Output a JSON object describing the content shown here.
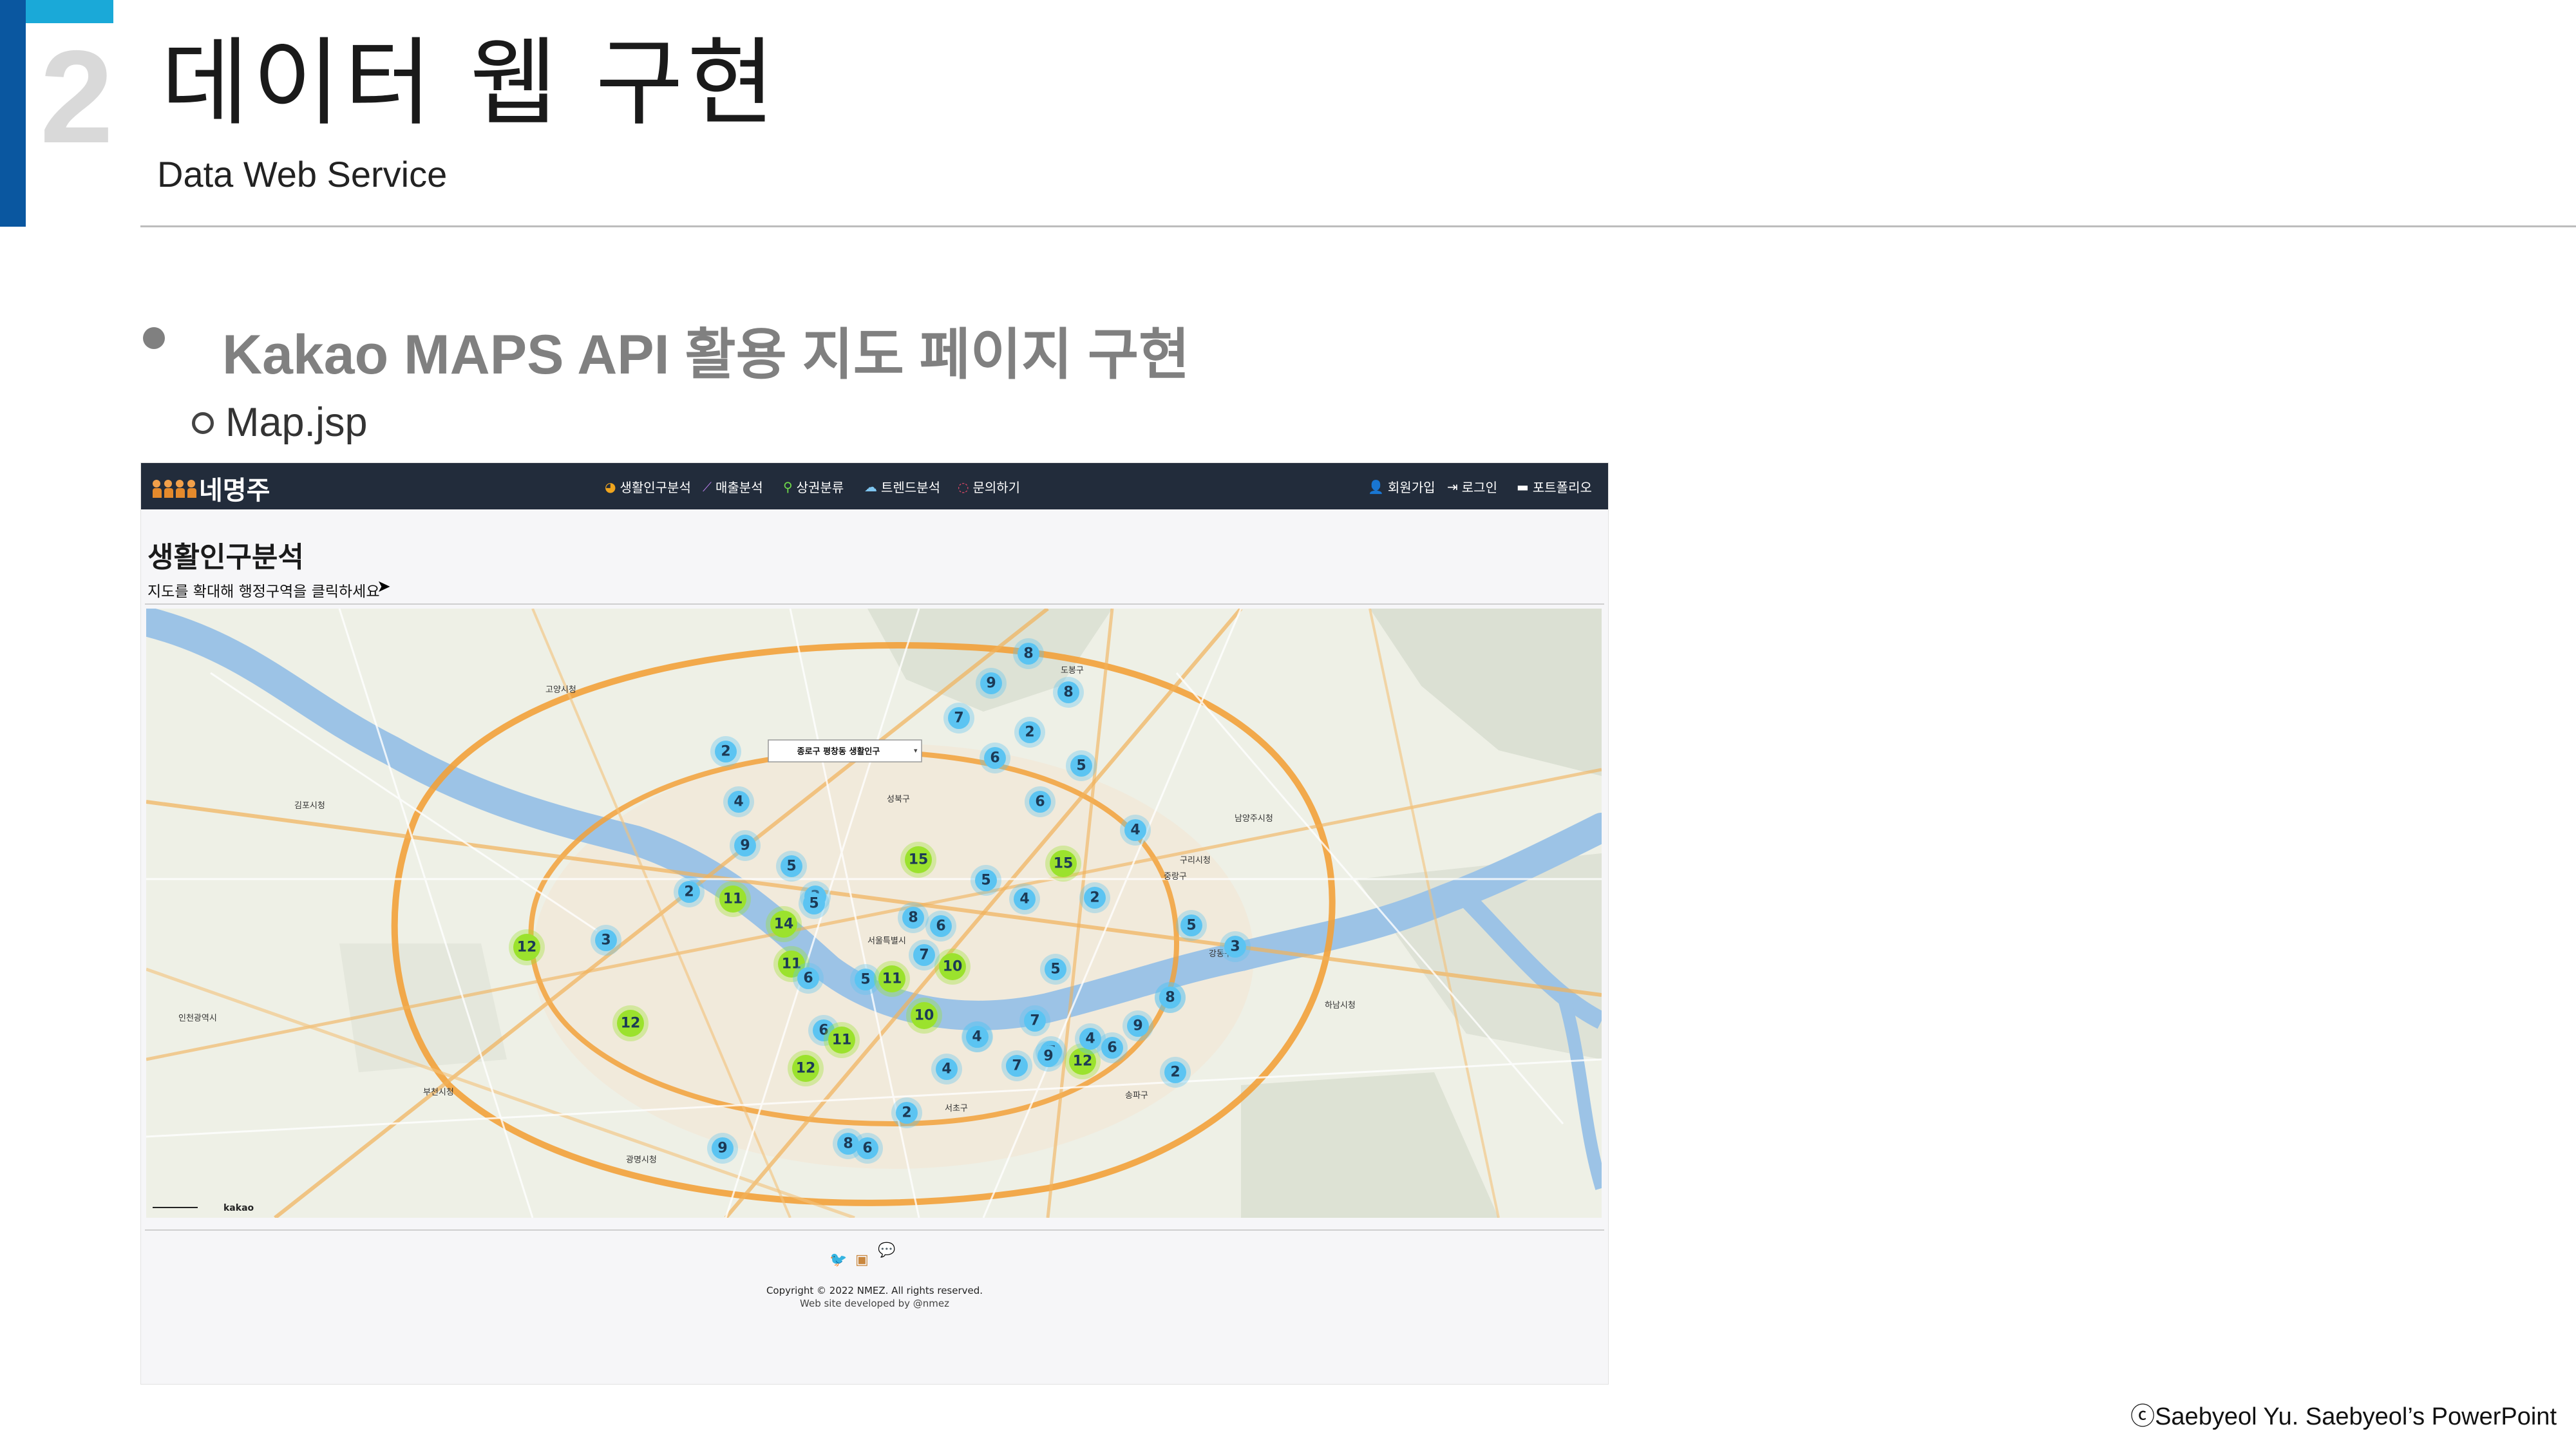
{
  "slide": {
    "section_number": "2",
    "title": "데이터 웹 구현",
    "subtitle": "Data Web Service",
    "bullet": "Kakao MAPS API 활용 지도 페이지 구현",
    "sub_bullet": "Map.jsp",
    "credit": "ⓒSaebyeol Yu. Saebyeol’s PowerPoint",
    "colors": {
      "accent_dark": "#0a57a0",
      "accent_light": "#1aa9d8",
      "number_gray": "#d9d9d9",
      "bullet_gray": "#808080"
    }
  },
  "site": {
    "logo_text": "네명주",
    "nav": [
      {
        "label": "생활인구분석",
        "icon": "pie-chart-icon",
        "color": "#f0a51e"
      },
      {
        "label": "매출분석",
        "icon": "line-chart-icon",
        "color": "#b77ce8"
      },
      {
        "label": "상권분류",
        "icon": "search-icon",
        "color": "#6fd84a"
      },
      {
        "label": "트렌드분석",
        "icon": "cloud-icon",
        "color": "#7fc6f0"
      },
      {
        "label": "문의하기",
        "icon": "chat-icon",
        "color": "#e84a6a"
      }
    ],
    "nav_right": [
      {
        "label": "회원가입",
        "icon": "user-icon"
      },
      {
        "label": "로그인",
        "icon": "sign-in-icon"
      },
      {
        "label": "포트폴리오",
        "icon": "folder-icon"
      }
    ],
    "page_title": "생활인구분석",
    "instruction": "지도를 확대해 행정구역을 클릭하세요",
    "map": {
      "provider": "kakao",
      "tooltip": "종로구 평창동 생활인구",
      "cluster_colors": {
        "small": "#5bc4f2",
        "large": "#9be22d"
      },
      "clusters": [
        8,
        9,
        8,
        7,
        2,
        6,
        5,
        2,
        4,
        6,
        4,
        9,
        5,
        15,
        15,
        2,
        5,
        11,
        14,
        3,
        8,
        6,
        2,
        4,
        5,
        11,
        10,
        5,
        7,
        3,
        12,
        11,
        6,
        5,
        7,
        12,
        3,
        5,
        8,
        7,
        4,
        7,
        12,
        9,
        4,
        6,
        10,
        6,
        7,
        9,
        4,
        11,
        4,
        12,
        2,
        2,
        8,
        9,
        6
      ],
      "labels": [
        "고양시청",
        "김포시청",
        "부천시청",
        "광명시청",
        "구리시청",
        "남양주시청",
        "하남시청",
        "서울특별시",
        "인천광역시",
        "도봉구",
        "성북구",
        "중랑구",
        "강동구",
        "서초구",
        "송파구"
      ]
    },
    "social_icons": [
      "twitter-icon",
      "facebook-icon",
      "kakaotalk-icon"
    ],
    "copyright": "Copyright © 2022 NMEZ. All rights reserved.",
    "developed": "Web site developed by @nmez"
  }
}
